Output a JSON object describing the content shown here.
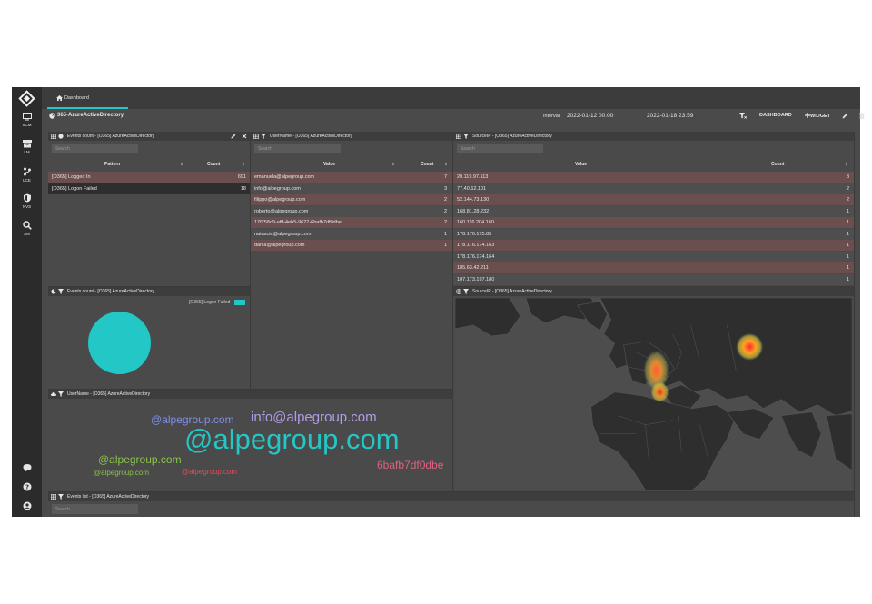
{
  "sidebar": {
    "items": [
      {
        "label": "SCM",
        "icon": "monitor-icon"
      },
      {
        "label": "LM",
        "icon": "archive-icon"
      },
      {
        "label": "LCE",
        "icon": "branch-icon"
      },
      {
        "label": "NVS",
        "icon": "shield-icon"
      },
      {
        "label": "SM",
        "icon": "search-icon"
      }
    ],
    "bottom": [
      "chat-icon",
      "help-icon",
      "user-icon"
    ]
  },
  "topbar": {
    "tab": "Dashboard"
  },
  "subbar": {
    "title": "365-AzureActiveDirectory",
    "interval_label": "Interval",
    "from": "2022-01-12 00:00",
    "to": "2022-01-18 23:59",
    "dashboard_btn": "DASHBOARD",
    "widget_btn": "WIDGET"
  },
  "accent": "#22c7c6",
  "panels": {
    "events_count_table": {
      "title": "Events count - [O365] AzureActiveDirectory",
      "search_placeholder": "Search",
      "col1": "Pattern",
      "col2": "Count",
      "rows": [
        {
          "pattern": "[O365] Logged In",
          "count": "691"
        },
        {
          "pattern": "[O365] Logon Failed",
          "count": "18"
        }
      ]
    },
    "username_table": {
      "title": "UserName - [O365] AzureActiveDirectory",
      "search_placeholder": "Search",
      "col1": "Value",
      "col2": "Count",
      "rows": [
        {
          "value": "emanuela@alpegroup.com",
          "count": "7"
        },
        {
          "value": "info@alpegroup.com",
          "count": "3"
        },
        {
          "value": "filippo@alpegroup.com",
          "count": "2"
        },
        {
          "value": "roberto@alpegroup.com",
          "count": "2"
        },
        {
          "value": "17f258d9-afff-4eb5-9627-6bafb7df0dbe",
          "count": "2"
        },
        {
          "value": "natascia@alpegroup.com",
          "count": "1"
        },
        {
          "value": "dania@alpegroup.com",
          "count": "1"
        }
      ]
    },
    "sourceip_table": {
      "title": "SourceIP - [O365] AzureActiveDirectory",
      "search_placeholder": "Search",
      "col1": "Value",
      "col2": "Count",
      "rows": [
        {
          "value": "20.119.97.113",
          "count": "3"
        },
        {
          "value": "77.40.62.101",
          "count": "2"
        },
        {
          "value": "52.144.73.130",
          "count": "2"
        },
        {
          "value": "168.81.28.232",
          "count": "1"
        },
        {
          "value": "160.116.204.160",
          "count": "1"
        },
        {
          "value": "178.176.175.85",
          "count": "1"
        },
        {
          "value": "178.176.174.163",
          "count": "1"
        },
        {
          "value": "178.176.174.164",
          "count": "1"
        },
        {
          "value": "185.63.42.211",
          "count": "1"
        },
        {
          "value": "107.173.197.180",
          "count": "1"
        }
      ]
    },
    "events_count_pie": {
      "title": "Events count - [O365] AzureActiveDirectory",
      "legend": "[O365] Logon Failed",
      "color": "#22c7c6"
    },
    "sourceip_map": {
      "title": "SourceIP - [O365] AzureActiveDirectory"
    },
    "username_cloud": {
      "title": "UserName - [O365] AzureActiveDirectory",
      "words": [
        {
          "text": "@alpegroup.com",
          "color": "#7f8ff0"
        },
        {
          "text": "info@alpegroup.com",
          "color": "#b29ce8"
        },
        {
          "text": "@alpegroup.com",
          "color": "#22c7c6"
        },
        {
          "text": "@alpegroup.com",
          "color": "#8ac34a"
        },
        {
          "text": "@alpegroup.com",
          "color": "#8ac34a"
        },
        {
          "text": "@alpegroup.com",
          "color": "#e04a5a"
        },
        {
          "text": "6bafb7df0dbe",
          "color": "#e06080"
        }
      ]
    },
    "events_list": {
      "title": "Events list - [O365] AzureActiveDirectory",
      "search_placeholder": "Search"
    }
  }
}
